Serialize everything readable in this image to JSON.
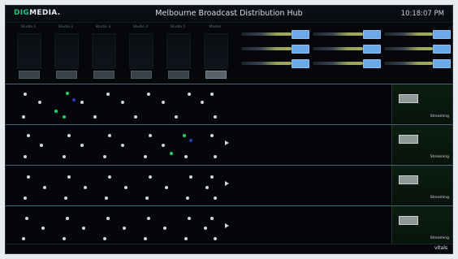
{
  "app": {
    "logo_text_left": "DIG",
    "logo_text_right": "MEDIA.",
    "title": "Melbourne Broadcast Distribution Hub",
    "clock": "10:18:07 PM"
  },
  "audio": {
    "channels": [
      {
        "name": "Studio 1",
        "button_active": false
      },
      {
        "name": "Studio 2",
        "button_active": false
      },
      {
        "name": "Studio 3",
        "button_active": false
      },
      {
        "name": "Studio 4",
        "button_active": false
      },
      {
        "name": "Studio 5",
        "button_active": false
      },
      {
        "name": "Master",
        "button_active": true
      }
    ]
  },
  "routes": {
    "items": [
      {
        "tag": ""
      },
      {
        "tag": ""
      },
      {
        "tag": ""
      },
      {
        "tag": ""
      },
      {
        "tag": ""
      },
      {
        "tag": ""
      },
      {
        "tag": ""
      },
      {
        "tag": ""
      },
      {
        "tag": ""
      }
    ]
  },
  "rows": [
    {
      "status": "Streaming"
    },
    {
      "status": "Streaming"
    },
    {
      "status": "Streaming"
    },
    {
      "status": "Streaming"
    }
  ],
  "footer": {
    "powered": "vitals"
  },
  "colors": {
    "accent_green": "#19c37d",
    "route_button": "#6aa8e8",
    "row_border": "#3f6c77"
  }
}
